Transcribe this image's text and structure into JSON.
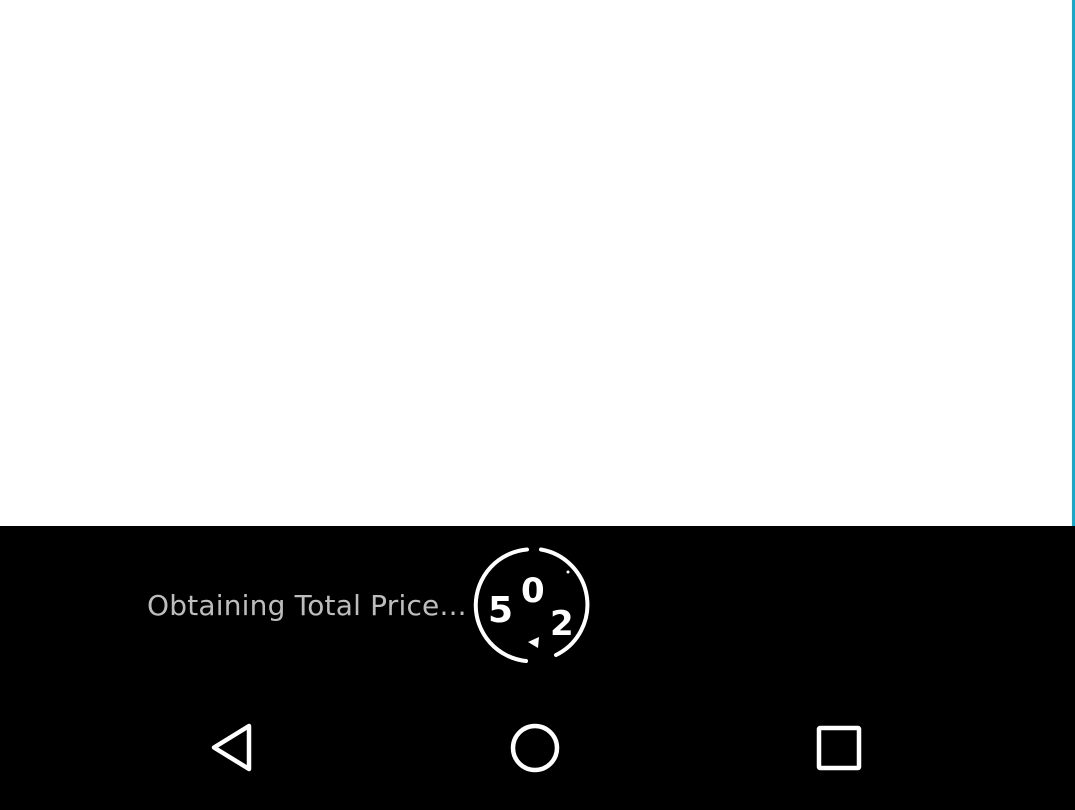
{
  "toast": {
    "message": "Obtaining Total Price...",
    "spinner_digits": [
      "0",
      "5",
      "2"
    ]
  },
  "navigation": {
    "back_icon": "back-triangle-icon",
    "home_icon": "home-circle-icon",
    "recents_icon": "recents-square-icon"
  },
  "colors": {
    "content_background": "#ffffff",
    "system_background": "#000000",
    "accent_edge": "#16a9c9",
    "toast_text": "#bdbdbd",
    "icon": "#ffffff"
  }
}
